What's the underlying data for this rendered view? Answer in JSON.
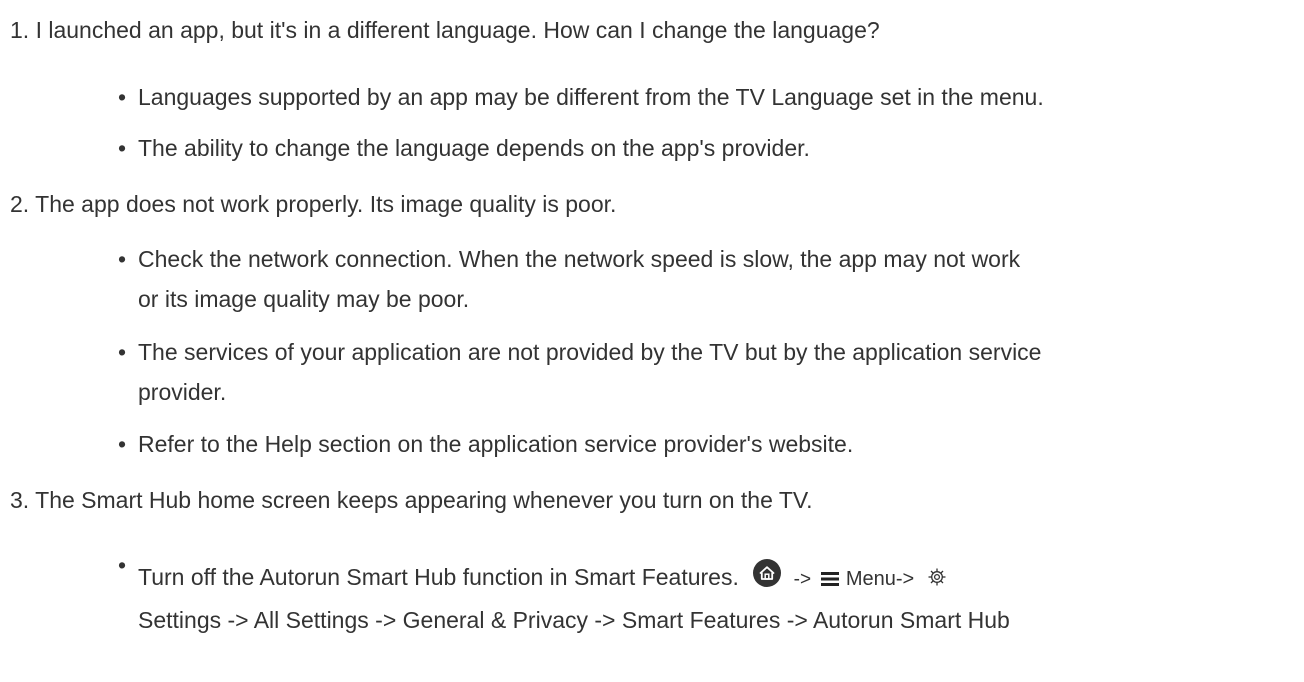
{
  "faq": {
    "items": [
      {
        "question": "1. I launched an app, but it's in a different language. How can I change the language?",
        "bullets": [
          "Languages supported by an app may be different from the TV Language set in the menu.",
          "The ability to change the language depends on the app's provider."
        ]
      },
      {
        "question": "2. The app does not work properly. Its image quality is poor.",
        "bullets": [
          {
            "line1": "Check the network connection. When the network speed is slow, the app may not work",
            "line2": "or its image quality may be poor."
          },
          {
            "line1": "The services of your application are not provided by the TV but by the application service",
            "line2": "provider."
          },
          "Refer to the Help section on the application service provider's website."
        ]
      },
      {
        "question": "3. The Smart Hub home screen keeps appearing whenever you turn on the TV.",
        "bullets": [
          {
            "text_before_icons": "Turn off the Autorun Smart Hub function in Smart Features.",
            "arrow1": "->",
            "menu_label": "Menu->",
            "path_line2": "Settings -> All Settings -> General & Privacy -> Smart Features -> Autorun Smart Hub"
          }
        ]
      }
    ],
    "bullet_char": "•"
  },
  "icons": {
    "home": "home-icon",
    "menu": "hamburger-menu-icon",
    "settings": "gear-icon"
  },
  "colors": {
    "text": "#333333",
    "home_icon_bg": "#333333",
    "background": "#ffffff"
  }
}
